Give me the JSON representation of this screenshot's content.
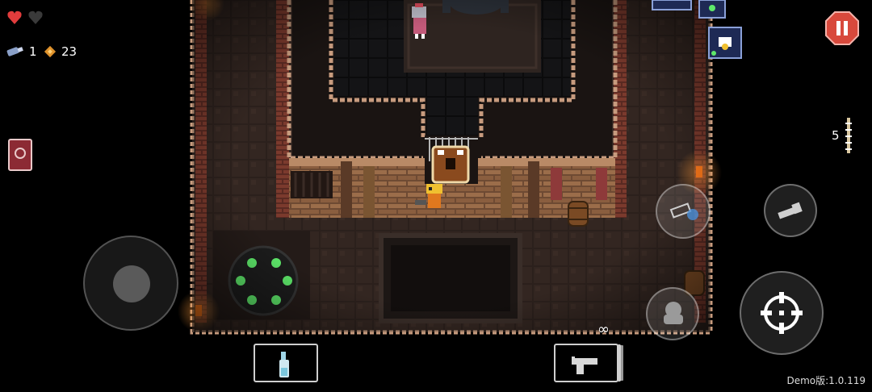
{
  "hud": {
    "hearts_full": 1,
    "hearts_total": 2,
    "blanks_count": "1",
    "shells_count": "23",
    "ammo_count": "5",
    "infinite_ammo_symbol": "∞"
  },
  "version_label": "Demo版:1.0.119",
  "icons": {
    "pause": "pause-icon",
    "minimap": "minimap-icon",
    "key": "key-icon",
    "blank": "blank-icon",
    "shell": "shell-currency-icon",
    "heart": "heart-icon",
    "map_book": "map-book-icon",
    "dodge_roll": "dodge-roll-icon",
    "interact": "interact-icon",
    "crosshair": "crosshair-icon",
    "active_item": "bottle-icon",
    "gun": "starter-pistol-icon"
  },
  "colors": {
    "pause_button": "#d8493c",
    "heart_red": "#e23c3c",
    "shell_gold": "#e0932c",
    "teleporter_green": "#5ee86a",
    "torch_orange": "#ff7a1a",
    "floor_dark": "#2a1f1b",
    "wall_brick": "#7a3b2e"
  }
}
